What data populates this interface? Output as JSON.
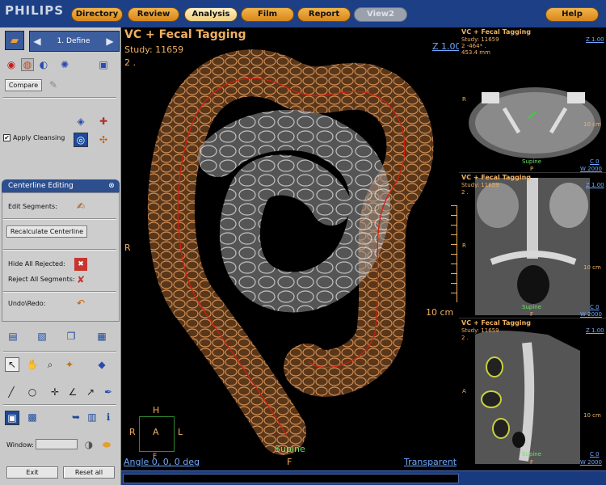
{
  "app": {
    "logo": "PHILIPS"
  },
  "tabs": [
    {
      "label": "Directory"
    },
    {
      "label": "Review"
    },
    {
      "label": "Analysis"
    },
    {
      "label": "Film"
    },
    {
      "label": "Report"
    },
    {
      "label": "View2"
    },
    {
      "label": "Help"
    }
  ],
  "left": {
    "step_label": "1. Define",
    "compare_label": "Compare",
    "apply_cleansing_label": "Apply Cleansing",
    "apply_cleansing_checked": true,
    "centerline_title": "Centerline  Editing",
    "edit_segments_label": "Edit Segments:",
    "recalculate_label": "Recalculate  Centerline",
    "hide_rejected_label": "Hide All Rejected:",
    "reject_all_label": "Reject All Segments:",
    "undo_redo_label": "Undo\\Redo:",
    "window_label": "Window:",
    "exit_label": "Exit",
    "reset_label": "Reset all"
  },
  "main": {
    "title": "VC + Fecal Tagging",
    "study": "Study: 11659",
    "series": "2 .",
    "zoom": "Z 1.00",
    "orient_left": "R",
    "scale": "10 cm",
    "position": "Supine",
    "bottom_orient": "F",
    "angle": "Angle 0, 0, 0 deg",
    "mode": "Transparent",
    "cube": {
      "top": "H",
      "left": "R",
      "center": "A",
      "right": "L",
      "bottom": "F"
    }
  },
  "panels": [
    {
      "title": "VC + Fecal Tagging",
      "study": "Study: 11659",
      "line2": "2 -464* .",
      "line3": "453.4 mm",
      "zoom": "Z 1.00",
      "side": "R",
      "scale": "10 cm",
      "position": "Supine",
      "pos2": "P",
      "c": "C 0",
      "w": "W 2000"
    },
    {
      "title": "VC + Fecal Tagging",
      "study": "Study: 11659",
      "line2": "2 .",
      "zoom": "Z 1.00",
      "side": "R",
      "scale": "10 cm",
      "position": "Supine",
      "pos2": "F",
      "c": "C 0",
      "w": "W 2000"
    },
    {
      "title": "VC + Fecal Tagging",
      "study": "Study: 11659",
      "line2": "2 .",
      "zoom": "Z 1.00",
      "side": "A",
      "scale": "10 cm",
      "position": "Supine",
      "pos2": "F",
      "c": "C 0",
      "w": "W 2000"
    }
  ]
}
